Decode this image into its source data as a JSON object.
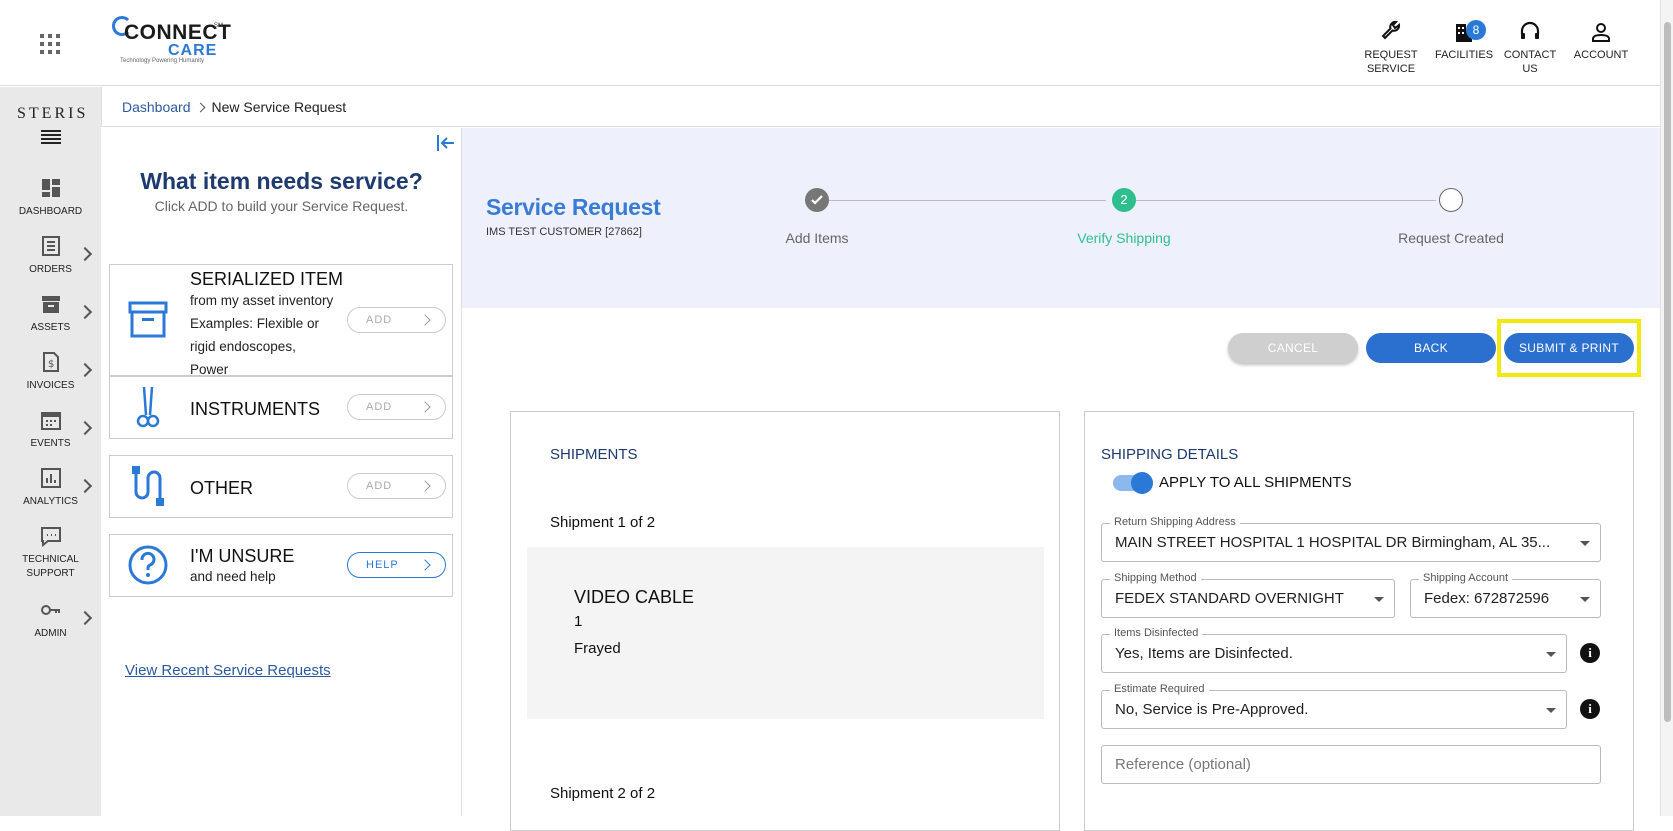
{
  "header": {
    "logo_word": "CONNECT",
    "logo_care": "CARE",
    "logo_tagline": "Technology Powering Humanity",
    "logo_sm": "SM",
    "nav": {
      "request_service": "REQUEST SERVICE",
      "facilities": "FACILITIES",
      "facilities_badge": "8",
      "contact_us": "CONTACT US",
      "account": "ACCOUNT"
    }
  },
  "sidebar": {
    "brand": "STERIS",
    "items": [
      "DASHBOARD",
      "ORDERS",
      "ASSETS",
      "INVOICES",
      "EVENTS",
      "ANALYTICS",
      "TECHNICAL SUPPORT",
      "ADMIN"
    ]
  },
  "breadcrumb": {
    "home": "Dashboard",
    "current": "New Service Request"
  },
  "left_panel": {
    "title": "What item needs service?",
    "subtitle": "Click ADD to build your Service Request.",
    "cards": {
      "serialized": {
        "title": "SERIALIZED ITEM",
        "line1": "from my asset inventory",
        "line2": "Examples: Flexible or",
        "line3": "rigid endoscopes,",
        "line4": "Power",
        "button": "ADD"
      },
      "instruments": {
        "title": "INSTRUMENTS",
        "button": "ADD"
      },
      "other": {
        "title": "OTHER",
        "button": "ADD"
      },
      "unsure": {
        "title": "I'M UNSURE",
        "desc": "and need help",
        "button": "HELP"
      }
    },
    "view_recent": "View Recent Service Requests"
  },
  "request": {
    "title": "Service Request",
    "customer": "IMS TEST CUSTOMER [27862]",
    "steps": {
      "s1": "Add Items",
      "s2": "Verify Shipping",
      "s2_num": "2",
      "s3": "Request Created"
    },
    "buttons": {
      "cancel": "CANCEL",
      "back": "BACK",
      "submit": "SUBMIT & PRINT"
    }
  },
  "shipments": {
    "title": "SHIPMENTS",
    "ship1_label": "Shipment 1 of 2",
    "item_name": "VIDEO CABLE",
    "item_qty": "1",
    "item_issue": "Frayed",
    "ship2_label": "Shipment 2 of 2"
  },
  "shipping_details": {
    "title": "SHIPPING DETAILS",
    "apply_all": "APPLY TO ALL SHIPMENTS",
    "return_address_label": "Return Shipping Address",
    "return_address_value": "MAIN STREET HOSPITAL 1 HOSPITAL DR Birmingham, AL 35...",
    "method_label": "Shipping Method",
    "method_value": "FEDEX STANDARD OVERNIGHT",
    "account_label": "Shipping Account",
    "account_value": "Fedex: 672872596",
    "disinfected_label": "Items Disinfected",
    "disinfected_value": "Yes, Items are Disinfected.",
    "estimate_label": "Estimate Required",
    "estimate_value": "No, Service is Pre-Approved.",
    "reference_placeholder": "Reference (optional)",
    "info_glyph": "i"
  },
  "colors": {
    "brand_blue": "#2b79d6",
    "navy": "#1e3a6e",
    "green": "#2fbf8f",
    "highlight": "#f2ea0e"
  }
}
